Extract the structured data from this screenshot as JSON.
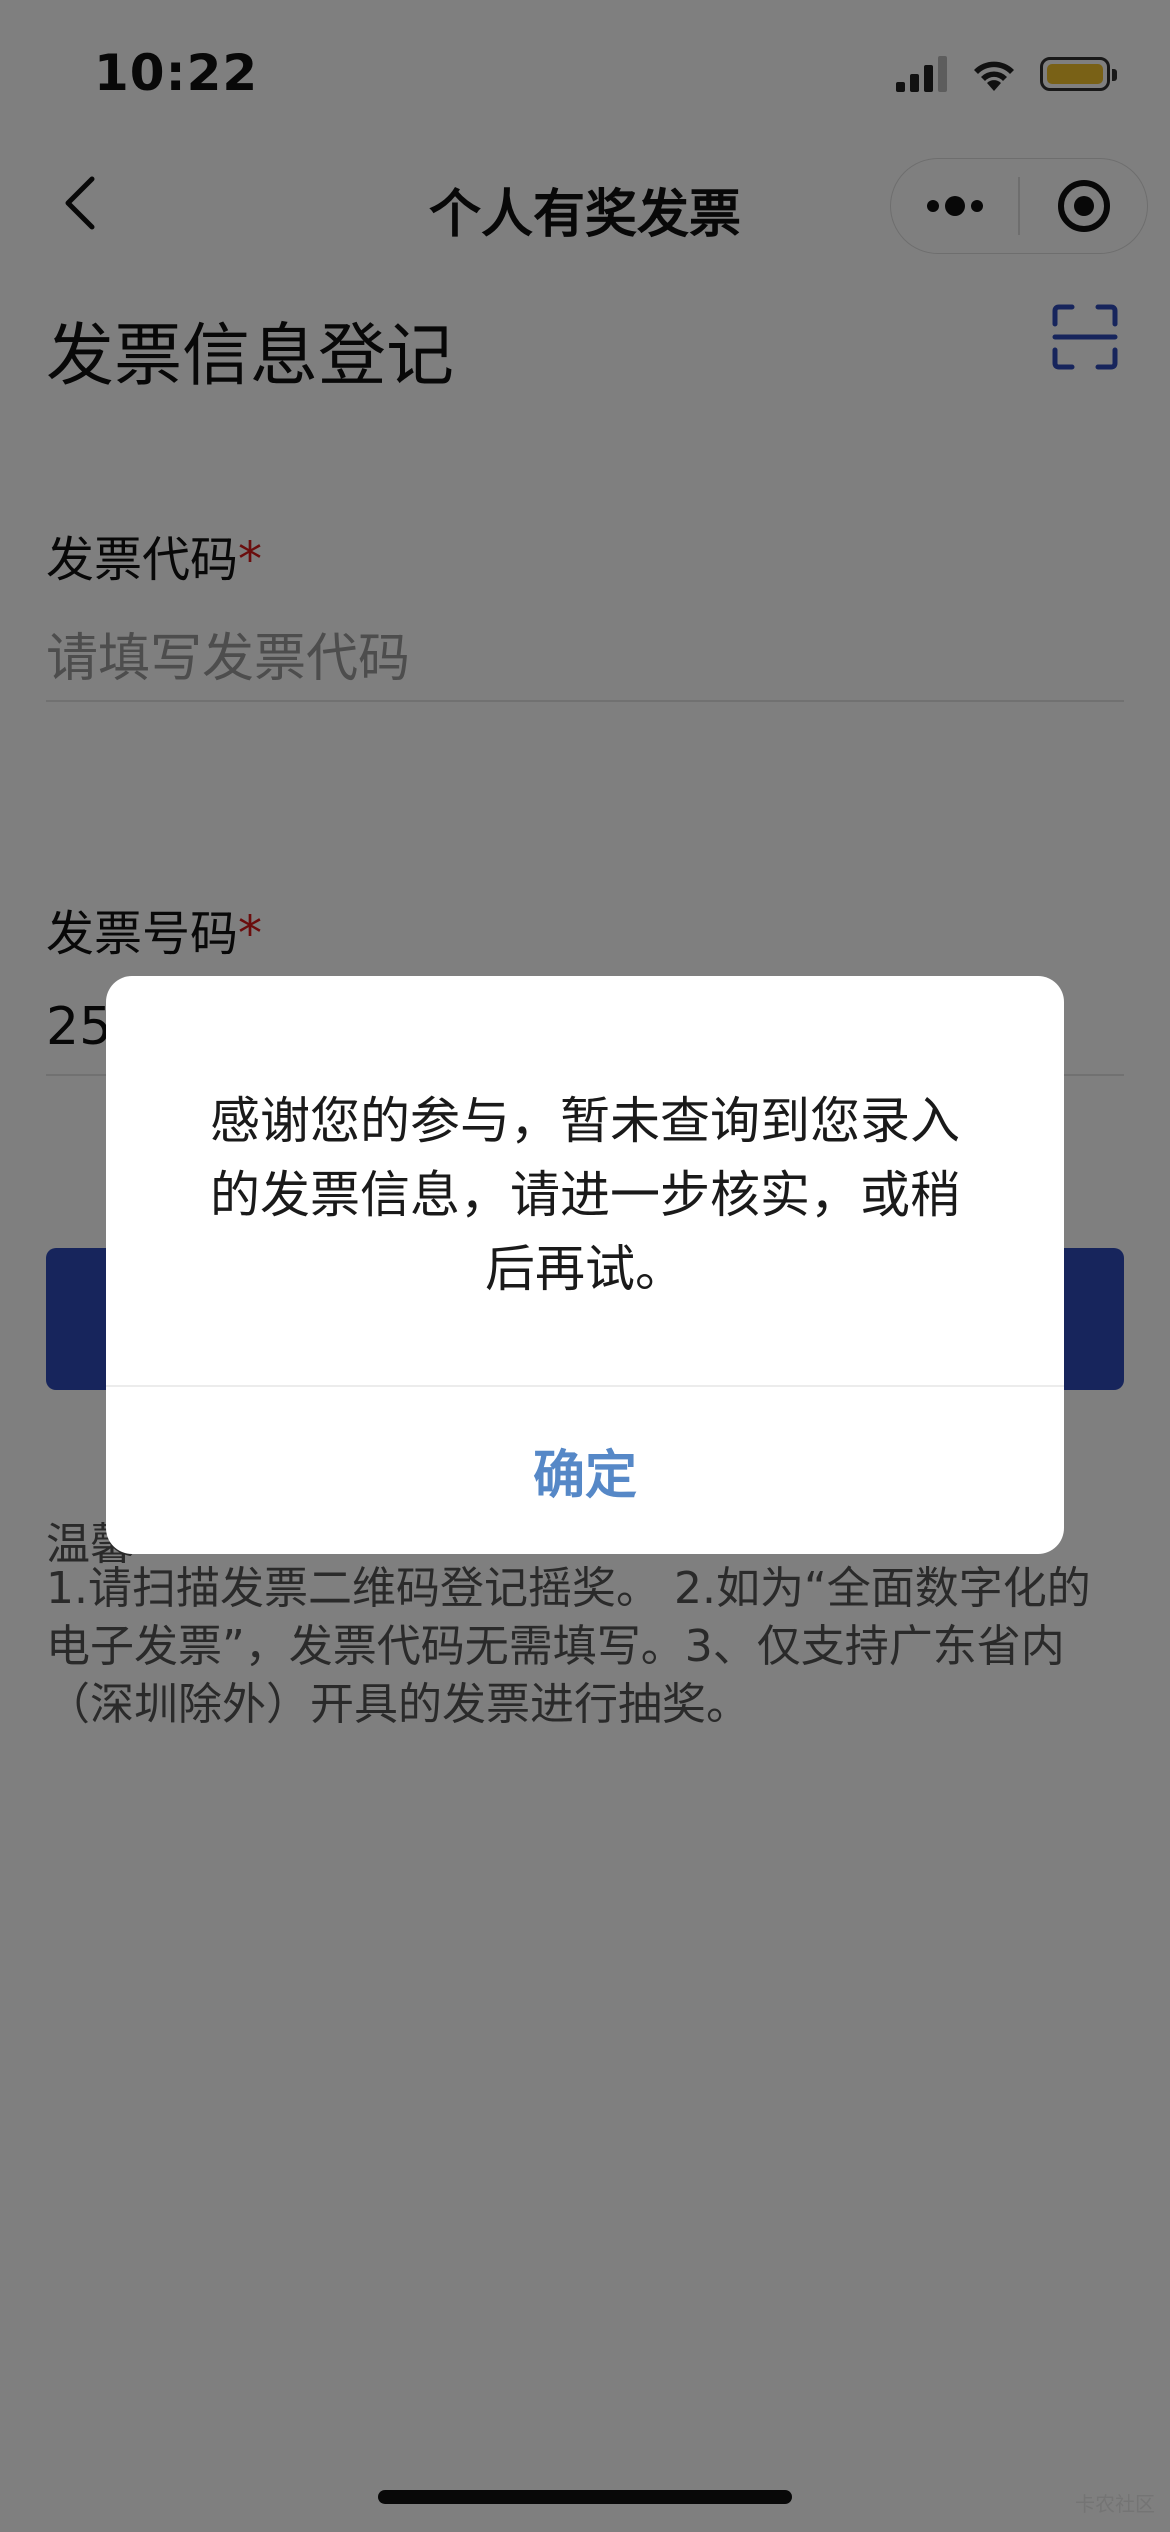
{
  "status_bar": {
    "time": "10:22"
  },
  "nav": {
    "title": "个人有奖发票"
  },
  "page": {
    "title": "发票信息登记"
  },
  "form": {
    "invoice_code": {
      "label": "发票代码",
      "required_mark": "*",
      "placeholder": "请填写发票代码"
    },
    "invoice_number": {
      "label": "发票号码",
      "required_mark": "*",
      "value": "25"
    },
    "submit_label": ""
  },
  "tips": {
    "title": "温馨",
    "body": "1.请扫描发票二维码登记摇奖。 2.如为“全面数字化的电子发票”，发票代码无需填写。3、仅支持广东省内（深圳除外）开具的发票进行抽奖。"
  },
  "dialog": {
    "message": "感谢您的参与，暂未查询到您录入的发票信息，请进一步核实，或稍后再试。",
    "confirm_label": "确定"
  },
  "watermark": "卡农社区",
  "colors": {
    "primary": "#2f4bb8",
    "required": "#d71a1a",
    "dialog_button": "#5688c7"
  }
}
